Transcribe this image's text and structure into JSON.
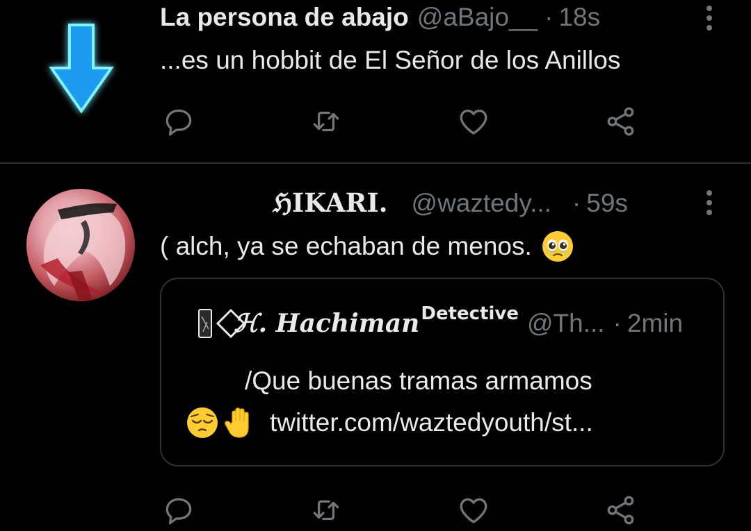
{
  "tweet1": {
    "arrow_icon": "down-arrow-icon",
    "arrow_color": "#1d9bf0",
    "name": "La persona de abajo",
    "handle": "@aBajo__",
    "separator": "·",
    "time": "18s",
    "text": "...es un hobbit de El Señor de los Anillos"
  },
  "tweet2": {
    "name": "ℌIKARI.",
    "handle": "@waztedy...",
    "separator": "·",
    "time": "59s",
    "text": "( alch, ya se echaban de menos.",
    "text_emoji": "pleading-face-icon",
    "quote": {
      "name": "ℋ. Hachiman",
      "badge": "Detective",
      "handle": "@Th...",
      "separator": "·",
      "time": "2min",
      "line1": "/Que buenas tramas armamos",
      "line2_emojis": [
        "pensive-face-icon",
        "raised-hand-icon"
      ],
      "link": "twitter.com/waztedyouth/st..."
    }
  },
  "actions": {
    "icons": [
      "reply-icon",
      "retweet-icon",
      "like-icon",
      "share-icon"
    ],
    "icon_color": "#71767b"
  },
  "colors": {
    "background": "#000000",
    "text_primary": "#e7e9ea",
    "text_secondary": "#71767b",
    "divider": "#2f3336"
  }
}
